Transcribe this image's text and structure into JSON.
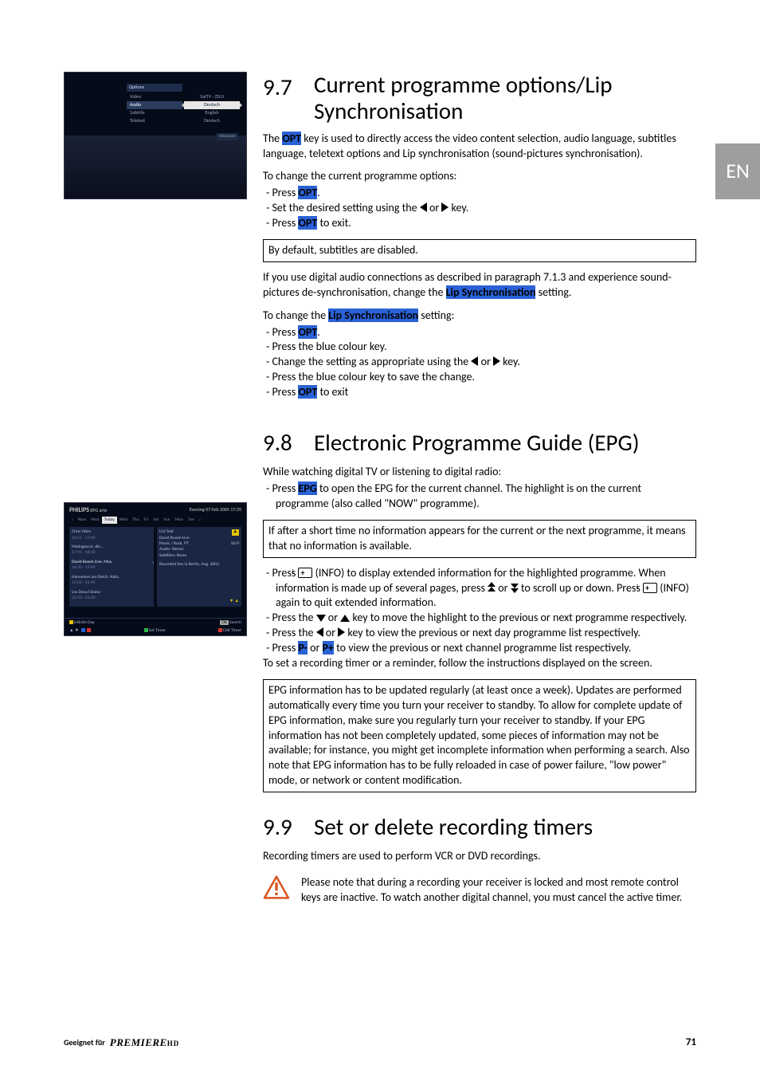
{
  "lang_tab": "EN",
  "screenshot1": {
    "title": "Options",
    "menu": [
      "Video",
      "Audio",
      "Subtitle",
      "Teletext"
    ],
    "values": [
      "SatTV - ZD:0",
      "Deutsch",
      "English",
      "Deutsch"
    ],
    "selected_index": 1,
    "advanced": "Advanced"
  },
  "screenshot2": {
    "brand": "PHILIPS",
    "hdr_left": "EPG",
    "hdr_ch": "arte",
    "hdr_right": "Evening 07 Feb 2005 17:35",
    "tabs": [
      "Now",
      "Next",
      "Today",
      "Wed",
      "Thu",
      "Fri",
      "Sat",
      "Sun",
      "Mon",
      "Tue"
    ],
    "tab_selected": 2,
    "left_items": [
      {
        "title": "Chris Yates",
        "time": "16:55 - 17:40"
      },
      {
        "title": "Madagascar, die...",
        "time": "17:45 - 18:30"
      },
      {
        "title": "David Bowie Live, Mus.",
        "time": "18:30 - 19:40"
      },
      {
        "title": "Hannelore am Deich, Natu.",
        "time": "19:50 - 21:40"
      },
      {
        "title": "Les Deux Falaise",
        "time": "21:50 - 23:20"
      }
    ],
    "left_selected": 2,
    "right_tabs": "List Text",
    "right_title": "David Bowie Live",
    "right_sub1": "Music / Rock, PT",
    "right_sub2": "Audio: Stereo",
    "right_sub3": "Subtitles: None",
    "right_rating": "16/9",
    "right_body": "Recorded live in Berlin, Aug. 2003",
    "foot_yellow": "Infinite Day",
    "foot_ok": "OK",
    "foot_search": "Search",
    "foot_blue_left_1": "",
    "foot_blue_left_2": "",
    "foot_set": "Set Timer",
    "foot_edit": "Edit Timer"
  },
  "s97": {
    "num": "9.7",
    "title": "Current programme options/Lip Synchronisation",
    "p1a": "The ",
    "p1b": "OPT",
    "p1c": " key is used to directly access the video content selection, audio language, subtitles language, teletext options and Lip synchronisation (sound-pictures synchronisation).",
    "p2": "To change the current programme options:",
    "b1a": "Press ",
    "b1b": "OPT",
    "b1c": ".",
    "b2a": "Set the desired setting using the ",
    "b2b": " or ",
    "b2c": " key.",
    "b3a": "Press ",
    "b3b": "OPT",
    "b3c": " to exit.",
    "note1": "By default, subtitles are disabled.",
    "p3a": "If you use digital audio connections as described in paragraph 7.1.3 and experience sound-pictures de-synchronisation, change the ",
    "p3b": "Lip Synchronisation",
    "p3c": " setting.",
    "p4a": "To change the ",
    "p4b": "Lip Synchronisation",
    "p4c": " setting:",
    "c1a": "Press ",
    "c1b": "OPT",
    "c1c": ".",
    "c2": "Press the blue colour key.",
    "c3a": "Change the setting as appropriate using the ",
    "c3b": " or ",
    "c3c": " key.",
    "c4": "Press the blue colour key to save the change.",
    "c5a": "Press ",
    "c5b": "OPT",
    "c5c": " to exit"
  },
  "s98": {
    "num": "9.8",
    "title": "Electronic Programme Guide (EPG)",
    "p1": "While watching digital TV or listening to digital radio:",
    "b1a": "Press ",
    "b1b": "EPG",
    "b1c": " to open the EPG for the current channel. The highlight is on the current programme (also called \"NOW\" programme).",
    "note1": "If after a short time no information appears for the current or the next programme, it means that no information is available.",
    "b2a": "Press ",
    "b2b": " (INFO) to display extended information for the highlighted programme. When information is made up of several pages, press ",
    "b2c": " or ",
    "b2d": " to scroll up or down. Press ",
    "b2e": " (INFO) again to quit extended information.",
    "b3a": "Press the ",
    "b3b": " or ",
    "b3c": " key to move the highlight to the previous or next programme respectively.",
    "b4a": "Press the ",
    "b4b": " or ",
    "b4c": " key to view the previous or next day programme list respectively.",
    "b5a": "Press ",
    "b5b": "P-",
    "b5c": " or ",
    "b5d": "P+",
    "b5e": " to view the previous or next channel programme list respectively.",
    "p2": "To set a recording timer or a reminder, follow the instructions displayed on the screen.",
    "note2": "EPG information has to be updated regularly (at least once a week). Updates are performed automatically every time you turn your receiver to standby. To allow for complete update of EPG information, make sure you regularly turn your receiver to standby. If your EPG information has not been completely updated, some pieces of information may not be available; for instance, you might get incomplete information when performing a search. Also note that EPG information has to be fully reloaded in case of power failure, \"low power\" mode, or network or content modification."
  },
  "s99": {
    "num": "9.9",
    "title": "Set or delete recording timers",
    "p1": "Recording timers are used to perform VCR or DVD recordings.",
    "warn": "Please note that during a recording your receiver is locked and most remote control keys are inactive. To watch another digital channel, you must cancel the active timer."
  },
  "footer": {
    "left1": "Geeignet für",
    "left2": "PREMIERE",
    "left3": "HD",
    "page": "71"
  }
}
